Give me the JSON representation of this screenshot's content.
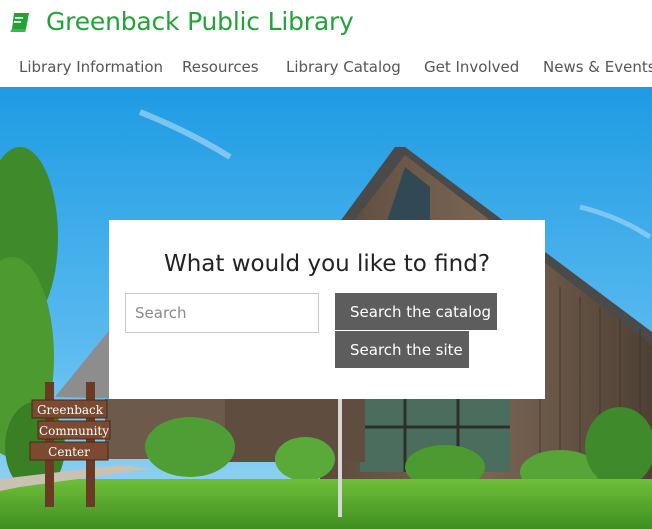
{
  "site": {
    "title": "Greenback Public Library",
    "brand_color": "#22a33a",
    "logo_icon": "book-icon"
  },
  "nav": {
    "items": [
      {
        "label": "Library Information"
      },
      {
        "label": "Resources"
      },
      {
        "label": "Library Catalog"
      },
      {
        "label": "Get Involved"
      },
      {
        "label": "News & Events"
      }
    ]
  },
  "hero": {
    "sign_lines": [
      "Greenback",
      "Community",
      "Center"
    ]
  },
  "search": {
    "heading": "What would you like to find?",
    "placeholder": "Search",
    "catalog_button": "Search the catalog",
    "site_button": "Search the site",
    "button_color": "#5d5d5d"
  }
}
